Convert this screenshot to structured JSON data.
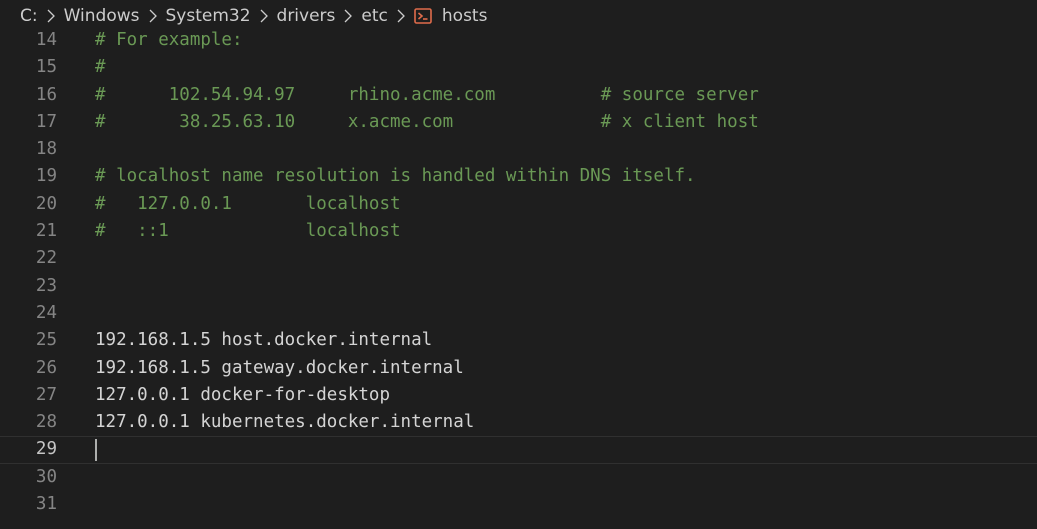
{
  "breadcrumb": {
    "items": [
      "C:",
      "Windows",
      "System32",
      "drivers",
      "etc"
    ],
    "file": "hosts"
  },
  "colors": {
    "background": "#1e1e1e",
    "comment": "#6a9955",
    "text": "#d4d4d4",
    "line_number": "#858585",
    "file_icon": "#e06c4b"
  },
  "editor": {
    "current_line": 29,
    "lines": [
      {
        "number": "14",
        "text": "# For example:",
        "type": "comment"
      },
      {
        "number": "15",
        "text": "#",
        "type": "comment"
      },
      {
        "number": "16",
        "text": "#      102.54.94.97     rhino.acme.com          # source server",
        "type": "comment"
      },
      {
        "number": "17",
        "text": "#       38.25.63.10     x.acme.com              # x client host",
        "type": "comment"
      },
      {
        "number": "18",
        "text": "",
        "type": "plain"
      },
      {
        "number": "19",
        "text": "# localhost name resolution is handled within DNS itself.",
        "type": "comment"
      },
      {
        "number": "20",
        "text": "#   127.0.0.1       localhost",
        "type": "comment"
      },
      {
        "number": "21",
        "text": "#   ::1             localhost",
        "type": "comment"
      },
      {
        "number": "22",
        "text": "",
        "type": "plain"
      },
      {
        "number": "23",
        "text": "",
        "type": "plain"
      },
      {
        "number": "24",
        "text": "",
        "type": "plain"
      },
      {
        "number": "25",
        "text": "192.168.1.5 host.docker.internal",
        "type": "plain"
      },
      {
        "number": "26",
        "text": "192.168.1.5 gateway.docker.internal",
        "type": "plain"
      },
      {
        "number": "27",
        "text": "127.0.0.1 docker-for-desktop",
        "type": "plain"
      },
      {
        "number": "28",
        "text": "127.0.0.1 kubernetes.docker.internal",
        "type": "plain"
      },
      {
        "number": "29",
        "text": "",
        "type": "plain"
      },
      {
        "number": "30",
        "text": "",
        "type": "plain"
      },
      {
        "number": "31",
        "text": "",
        "type": "plain"
      }
    ]
  }
}
